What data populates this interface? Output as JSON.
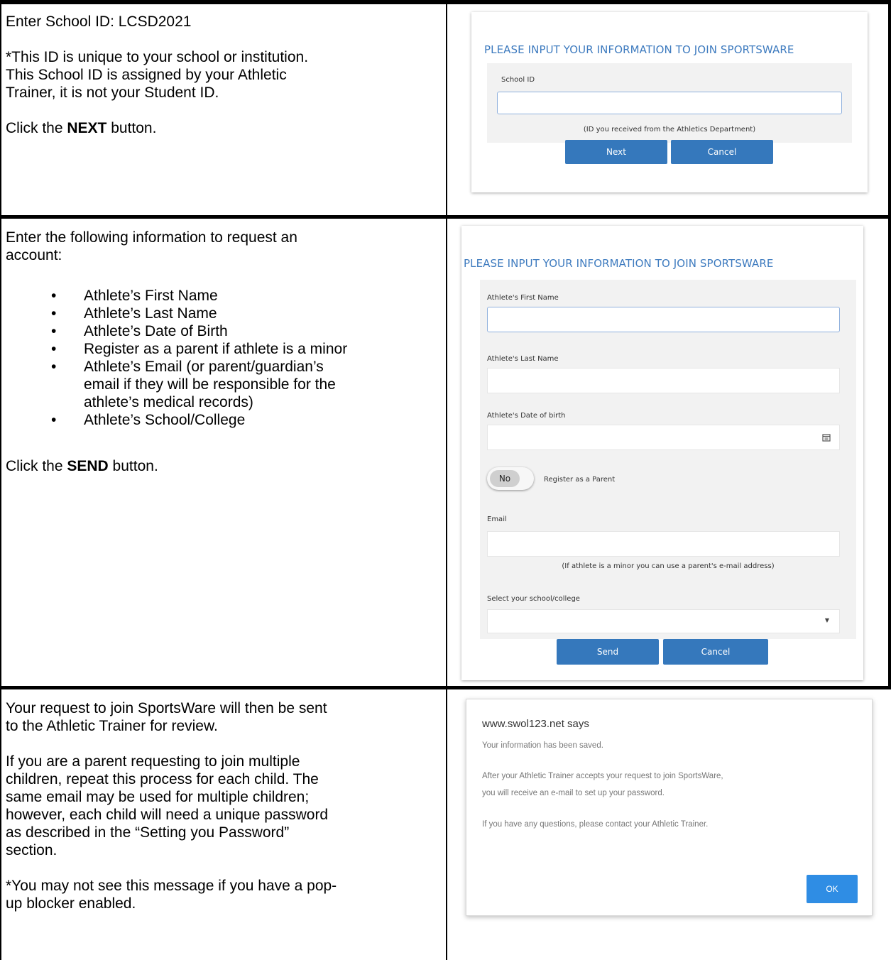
{
  "row1": {
    "left": {
      "line1": "Enter School ID: LCSD2021",
      "note_line1": "*This ID is unique to your school or institution.",
      "note_line2": "This School ID is assigned by your Athletic",
      "note_line3": "Trainer, it is not your Student ID.",
      "click_prefix": "Click the ",
      "click_bold": "NEXT",
      "click_suffix": " button."
    },
    "card": {
      "title": "PLEASE INPUT YOUR INFORMATION TO JOIN SPORTSWARE",
      "field_label": "School ID",
      "field_value": "",
      "hint": "(ID you received from the Athletics Department)",
      "next_label": "Next",
      "cancel_label": "Cancel"
    }
  },
  "row2": {
    "left": {
      "intro_line1": "Enter the following information to request an",
      "intro_line2": "account:",
      "items": [
        [
          "Athlete’s First Name"
        ],
        [
          "Athlete’s Last Name"
        ],
        [
          "Athlete’s Date of Birth"
        ],
        [
          "Register as a parent if athlete is a minor"
        ],
        [
          "Athlete’s Email (or parent/guardian’s",
          "email if they will be responsible for the",
          "athlete’s medical records)"
        ],
        [
          "Athlete’s School/College"
        ]
      ],
      "click_prefix": "Click the ",
      "click_bold": "SEND",
      "click_suffix": " button."
    },
    "card": {
      "title": "PLEASE INPUT YOUR INFORMATION TO JOIN SPORTSWARE",
      "first_name_label": "Athlete's First Name",
      "last_name_label": "Athlete's Last Name",
      "dob_label": "Athlete's Date of birth",
      "toggle_value": "No",
      "toggle_label": "Register as a Parent",
      "email_label": "Email",
      "email_hint": "(If athlete is a minor you can use a parent's e-mail address)",
      "school_label": "Select your school/college",
      "send_label": "Send",
      "cancel_label": "Cancel"
    }
  },
  "row3": {
    "left": {
      "p1_line1": "Your request to join SportsWare will then be sent",
      "p1_line2": "to the Athletic Trainer for review.",
      "p2_line1": "If you are a parent requesting to join multiple",
      "p2_line2": "children, repeat this process for each child. The",
      "p2_line3": "same email may be used for multiple children;",
      "p2_line4": "however, each child will need a unique password",
      "p2_line5": "as described in the “Setting you Password”",
      "p2_line6": "section.",
      "p3_line1": "*You may not see this message if you have a pop-",
      "p3_line2": "up blocker enabled."
    },
    "dialog": {
      "site": "www.swol123.net says",
      "line1": "Your information has been saved.",
      "line2": "After your Athletic Trainer accepts your request to join SportsWare,",
      "line3": "you will receive an e-mail to set up your password.",
      "line4": "If you have any questions, please contact your Athletic Trainer.",
      "ok_label": "OK"
    }
  },
  "colors": {
    "title_blue": "#3e7bbf",
    "button_blue": "#3578bc",
    "ok_blue": "#2f8de4",
    "field_gray": "#f2f2f2"
  }
}
